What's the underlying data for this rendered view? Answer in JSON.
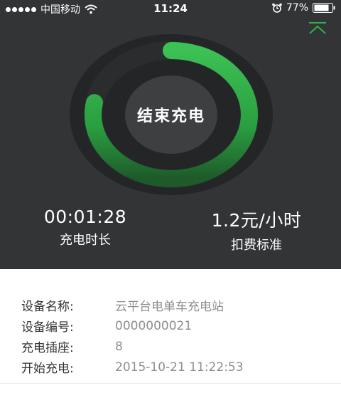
{
  "status_bar": {
    "carrier": "中国移动",
    "time": "11:24",
    "battery": "77%"
  },
  "charging": {
    "progress": 0.78,
    "stop_button": "结束充电",
    "duration_value": "00:01:28",
    "duration_label": "充电时长",
    "rate_value": "1.2元/小时",
    "rate_label": "扣费标准",
    "accent_color": "#2fb34a"
  },
  "details": [
    {
      "key": "设备名称:",
      "value": "云平台电单车充电站"
    },
    {
      "key": "设备编号:",
      "value": "0000000021"
    },
    {
      "key": "充电插座:",
      "value": "8"
    },
    {
      "key": "开始充电:",
      "value": "2015-10-21 11:22:53"
    }
  ],
  "icons": {
    "collapse": "chevron-up-icon",
    "wifi": "wifi-icon",
    "alarm": "alarm-icon",
    "battery": "battery-icon"
  }
}
